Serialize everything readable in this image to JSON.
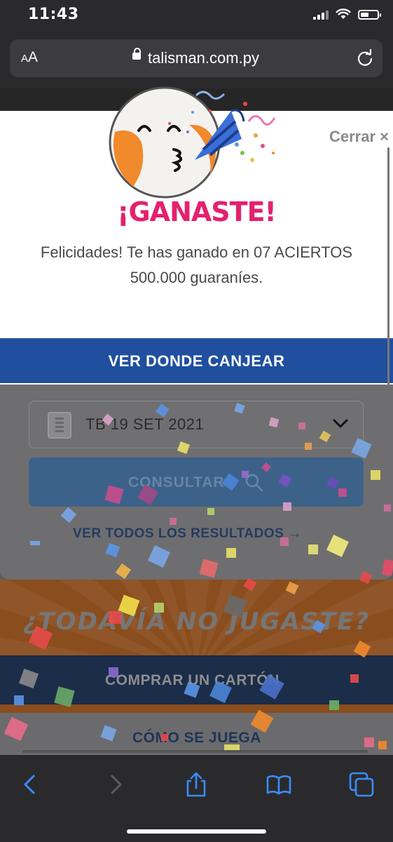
{
  "status_bar": {
    "time": "11:43"
  },
  "browser": {
    "text_size_button": "AA",
    "url": "talisman.com.py"
  },
  "modal": {
    "close_label": "Cerrar ×",
    "title": "¡GANASTE!",
    "message_line1": "Felicidades! Te has ganado en 07 ACIERTOS",
    "message_line2": "500.000 guaraníes.",
    "cta_label": "VER DONDE CANJEAR"
  },
  "results": {
    "date_value": "TB 19 SET 2021",
    "consult_label": "CONSULTAR",
    "all_results_label": "VER TODOS LOS RESULTADOS →"
  },
  "promo": {
    "headline": "¿TODAVÍA NO JUGASTE?",
    "buy_label": "COMPRAR UN CARTÓN",
    "how_label": "CÓMO SE JUEGA"
  },
  "colors": {
    "accent_blue": "#1f4f9e",
    "win_pink": "#e4216f",
    "brand_orange": "#f08a2c"
  },
  "icons": [
    "lock-icon",
    "reload-icon",
    "calendar-icon",
    "chevron-down-icon",
    "search-icon",
    "back-icon",
    "forward-icon",
    "share-icon",
    "bookmarks-icon",
    "tabs-icon"
  ]
}
